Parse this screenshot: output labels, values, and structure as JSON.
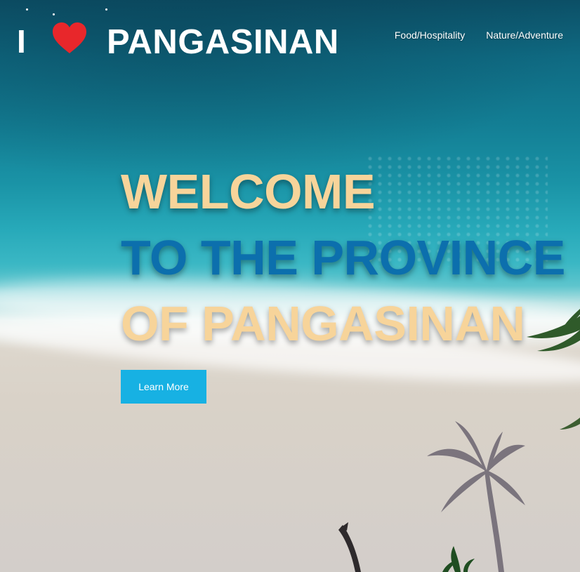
{
  "logo": {
    "i": "I",
    "name": "PANGASINAN"
  },
  "nav": {
    "items": [
      "Food/Hospitality",
      "Nature/Adventure"
    ]
  },
  "hero": {
    "line1": "WELCOME",
    "line2": "TO THE PROVINCE",
    "line3": "OF PANGASINAN",
    "cta_label": "Learn More"
  },
  "colors": {
    "heading_sand": "#f7d49a",
    "heading_blue": "#0c6fad",
    "button": "#17b1e3",
    "heart": "#e8272b"
  },
  "icons": [
    "heart-icon"
  ]
}
